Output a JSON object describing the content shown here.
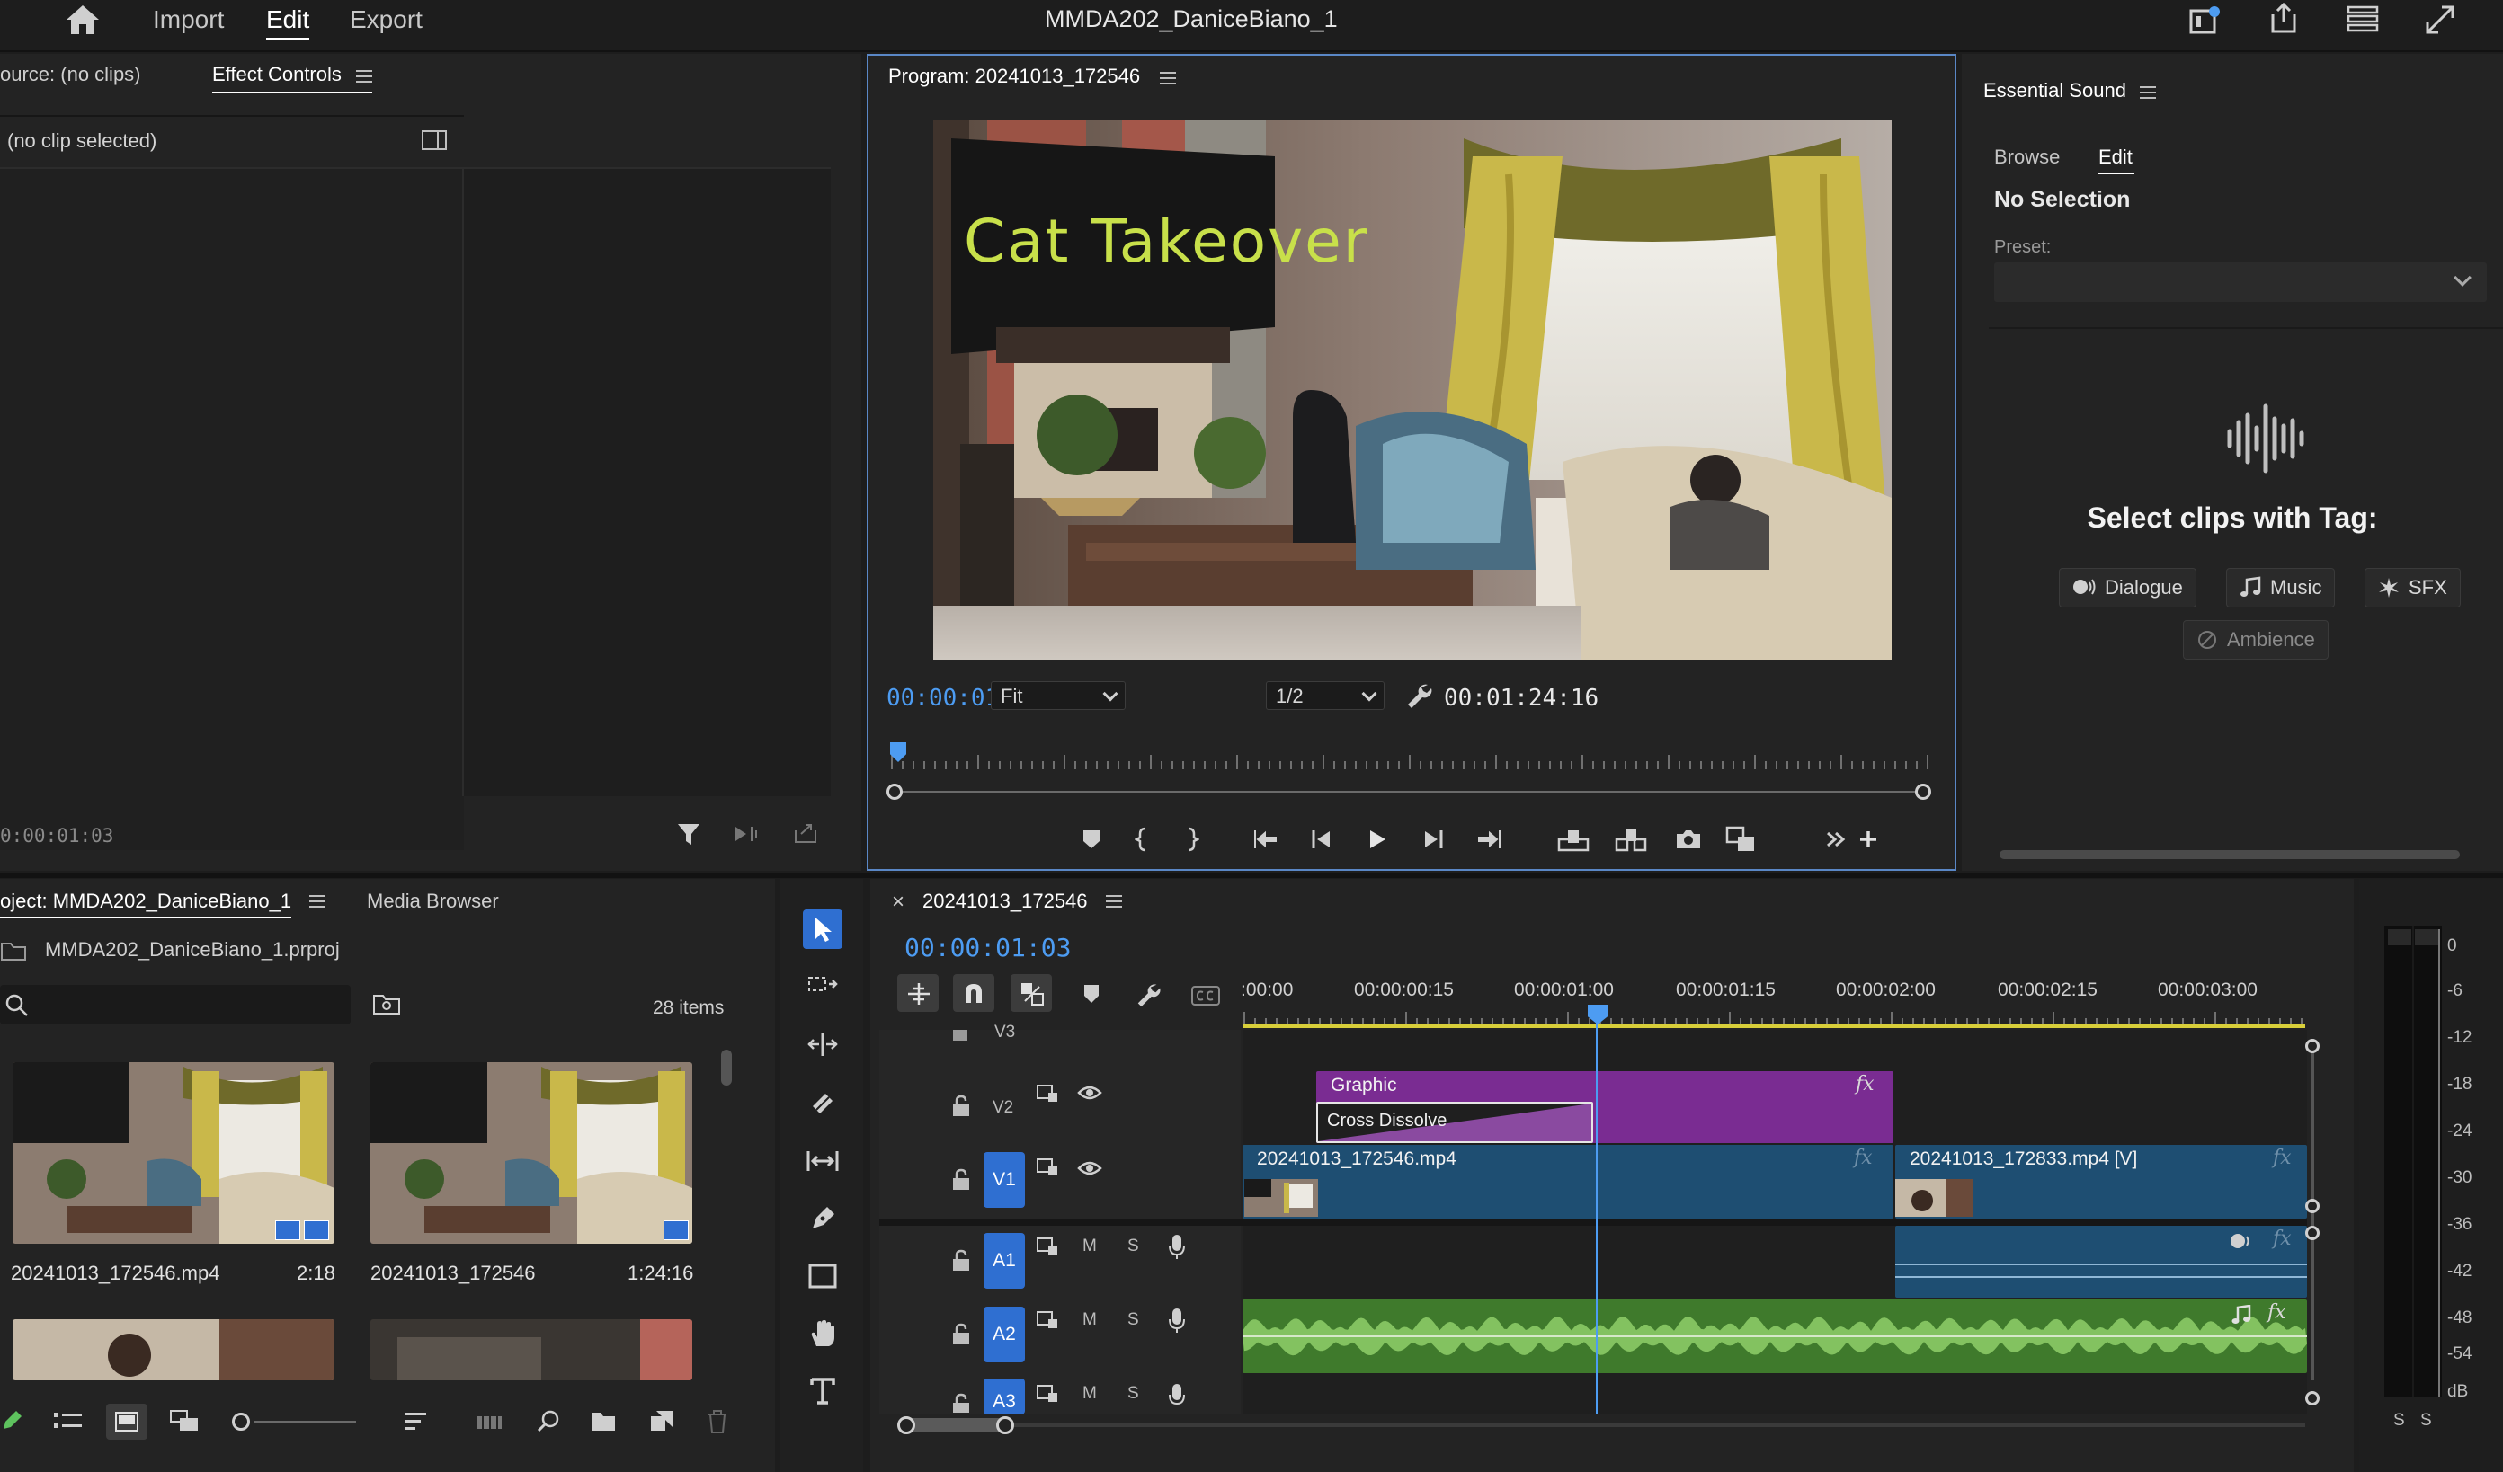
{
  "header": {
    "nav": [
      "Import",
      "Edit",
      "Export"
    ],
    "active_nav": "Edit",
    "project_title": "MMDA202_DaniceBiano_1",
    "icons": [
      "home-icon",
      "quick-export-icon",
      "share-icon",
      "workspaces-icon",
      "fullscreen-icon"
    ]
  },
  "source_panel": {
    "tab_source": "ource: (no clips)",
    "tab_effect_controls": "Effect Controls",
    "no_clip": "(no clip selected)",
    "timecode": "0:00:01:03"
  },
  "program": {
    "title": "Program: 20241013_172546",
    "overlay_title": "Cat  Takeover",
    "current_time": "00:00:01:03",
    "zoom": "Fit",
    "resolution": "1/2",
    "duration": "00:01:24:16"
  },
  "essential_sound": {
    "title": "Essential Sound",
    "tabs": [
      "Browse",
      "Edit"
    ],
    "active_tab": "Edit",
    "selection": "No Selection",
    "preset_label": "Preset:",
    "preset_value": "",
    "prompt": "Select clips with Tag:",
    "tags": [
      "Dialogue",
      "Music",
      "SFX",
      "Ambience"
    ]
  },
  "project": {
    "tab_project": "oject: MMDA202_DaniceBiano_1",
    "tab_media_browser": "Media Browser",
    "file": "MMDA202_DaniceBiano_1.prproj",
    "search_placeholder": "",
    "item_count": "28 items",
    "items": [
      {
        "name": "20241013_172546.mp4",
        "duration": "2:18"
      },
      {
        "name": "20241013_172546",
        "duration": "1:24:16"
      }
    ]
  },
  "timeline": {
    "tab": "20241013_172546",
    "close": "×",
    "current_time": "00:00:01:03",
    "ruler": [
      ":00:00",
      "00:00:00:15",
      "00:00:01:00",
      "00:00:01:15",
      "00:00:02:00",
      "00:00:02:15",
      "00:00:03:00"
    ],
    "tracks": [
      "V3",
      "V2",
      "V1",
      "A1",
      "A2",
      "A3"
    ],
    "audio_buttons": [
      "M",
      "S"
    ],
    "clips": {
      "graphic": "Graphic",
      "transition": "Cross Dissolve",
      "v1_a": "20241013_172546.mp4",
      "v1_b": "20241013_172833.mp4 [V]"
    },
    "fx_label": "fx"
  },
  "meter": {
    "scale": [
      "0",
      "-6",
      "-12",
      "-18",
      "-24",
      "-30",
      "-36",
      "-42",
      "-48",
      "-54",
      "dB"
    ],
    "solo": [
      "S",
      "S"
    ]
  },
  "colors": {
    "accent": "#4d9cf2",
    "graphic_clip": "#7a2c92",
    "video_clip": "#1e4e72",
    "audio_clip": "#3f7a2c",
    "track_badge": "#2f6fd1"
  }
}
